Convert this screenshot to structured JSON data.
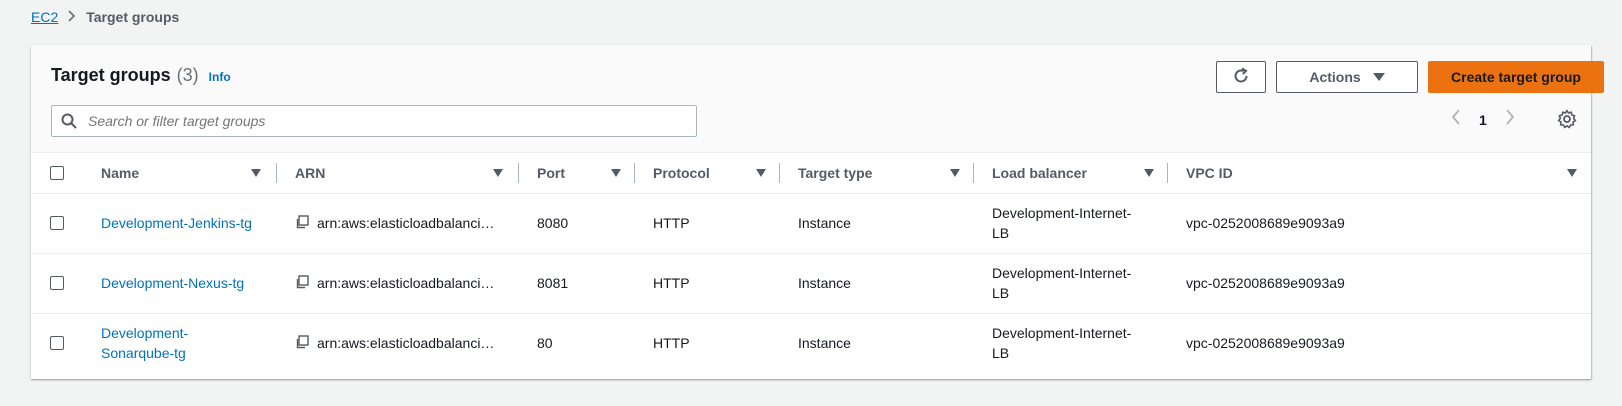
{
  "breadcrumb": {
    "root": "EC2",
    "current": "Target groups"
  },
  "header": {
    "title": "Target groups",
    "count": "(3)",
    "info": "Info"
  },
  "toolbar": {
    "refresh_icon": "refresh-icon",
    "actions_label": "Actions",
    "create_label": "Create target group"
  },
  "search": {
    "placeholder": "Search or filter target groups",
    "value": ""
  },
  "pagination": {
    "page": "1"
  },
  "table": {
    "columns": [
      "Name",
      "ARN",
      "Port",
      "Protocol",
      "Target type",
      "Load balancer",
      "VPC ID"
    ],
    "rows": [
      {
        "name": "Development-Jenkins-tg",
        "name_lines": [
          "Development-Jenkins-tg"
        ],
        "arn": "arn:aws:elasticloadbalanci…",
        "port": "8080",
        "protocol": "HTTP",
        "target_type": "Instance",
        "lb_lines": [
          "Development-Internet-",
          "LB"
        ],
        "vpc": "vpc-0252008689e9093a9"
      },
      {
        "name": "Development-Nexus-tg",
        "name_lines": [
          "Development-Nexus-tg"
        ],
        "arn": "arn:aws:elasticloadbalanci…",
        "port": "8081",
        "protocol": "HTTP",
        "target_type": "Instance",
        "lb_lines": [
          "Development-Internet-",
          "LB"
        ],
        "vpc": "vpc-0252008689e9093a9"
      },
      {
        "name": "Development-Sonarqube-tg",
        "name_lines": [
          "Development-",
          "Sonarqube-tg"
        ],
        "arn": "arn:aws:elasticloadbalanci…",
        "port": "80",
        "protocol": "HTTP",
        "target_type": "Instance",
        "lb_lines": [
          "Development-Internet-",
          "LB"
        ],
        "vpc": "vpc-0252008689e9093a9"
      }
    ]
  },
  "colors": {
    "link": "#0073bb",
    "primary": "#ec7211",
    "text": "#16191f",
    "muted": "#545b64"
  }
}
